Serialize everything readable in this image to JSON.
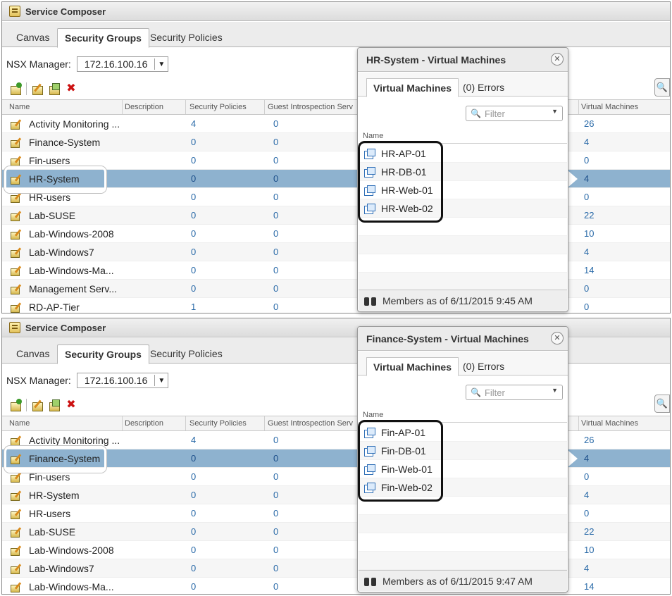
{
  "panels": [
    {
      "window_title": "Service Composer",
      "tabs": [
        "Canvas",
        "Security Groups",
        "Security Policies"
      ],
      "nsx_manager_label": "NSX Manager:",
      "nsx_manager_value": "172.16.100.16",
      "columns": [
        "Name",
        "Description",
        "Security Policies",
        "Guest Introspection Serv",
        "Virtual Machines"
      ],
      "rows": [
        {
          "name": "Activity Monitoring ...",
          "policies": "4",
          "gis": "0",
          "vms": "26"
        },
        {
          "name": "Finance-System",
          "policies": "0",
          "gis": "0",
          "vms": "4"
        },
        {
          "name": "Fin-users",
          "policies": "0",
          "gis": "0",
          "vms": "0"
        },
        {
          "name": "HR-System",
          "policies": "0",
          "gis": "0",
          "vms": "4"
        },
        {
          "name": "HR-users",
          "policies": "0",
          "gis": "0",
          "vms": "0"
        },
        {
          "name": "Lab-SUSE",
          "policies": "0",
          "gis": "0",
          "vms": "22"
        },
        {
          "name": "Lab-Windows-2008",
          "policies": "0",
          "gis": "0",
          "vms": "10"
        },
        {
          "name": "Lab-Windows7",
          "policies": "0",
          "gis": "0",
          "vms": "4"
        },
        {
          "name": "Lab-Windows-Ma...",
          "policies": "0",
          "gis": "0",
          "vms": "14"
        },
        {
          "name": "Management Serv...",
          "policies": "0",
          "gis": "0",
          "vms": "0"
        },
        {
          "name": "RD-AP-Tier",
          "policies": "1",
          "gis": "0",
          "vms": "0"
        }
      ],
      "popup": {
        "title": "HR-System - Virtual Machines",
        "tab_vms": "Virtual Machines",
        "tab_errors": "(0) Errors",
        "filter_placeholder": "Filter",
        "list_header": "Name",
        "vms": [
          "HR-AP-01",
          "HR-DB-01",
          "HR-Web-01",
          "HR-Web-02"
        ],
        "footer": "Members as of 6/11/2015 9:45 AM"
      }
    },
    {
      "window_title": "Service Composer",
      "tabs": [
        "Canvas",
        "Security Groups",
        "Security Policies"
      ],
      "nsx_manager_label": "NSX Manager:",
      "nsx_manager_value": "172.16.100.16",
      "columns": [
        "Name",
        "Description",
        "Security Policies",
        "Guest Introspection Serv",
        "Virtual Machines"
      ],
      "rows": [
        {
          "name": "Activity Monitoring ...",
          "policies": "4",
          "gis": "0",
          "vms": "26"
        },
        {
          "name": "Finance-System",
          "policies": "0",
          "gis": "0",
          "vms": "4"
        },
        {
          "name": "Fin-users",
          "policies": "0",
          "gis": "0",
          "vms": "0"
        },
        {
          "name": "HR-System",
          "policies": "0",
          "gis": "0",
          "vms": "4"
        },
        {
          "name": "HR-users",
          "policies": "0",
          "gis": "0",
          "vms": "0"
        },
        {
          "name": "Lab-SUSE",
          "policies": "0",
          "gis": "0",
          "vms": "22"
        },
        {
          "name": "Lab-Windows-2008",
          "policies": "0",
          "gis": "0",
          "vms": "10"
        },
        {
          "name": "Lab-Windows7",
          "policies": "0",
          "gis": "0",
          "vms": "4"
        },
        {
          "name": "Lab-Windows-Ma...",
          "policies": "0",
          "gis": "0",
          "vms": "14"
        }
      ],
      "popup": {
        "title": "Finance-System - Virtual Machines",
        "tab_vms": "Virtual Machines",
        "tab_errors": "(0) Errors",
        "filter_placeholder": "Filter",
        "list_header": "Name",
        "vms": [
          "Fin-AP-01",
          "Fin-DB-01",
          "Fin-Web-01",
          "Fin-Web-02"
        ],
        "footer": "Members as of 6/11/2015 9:47 AM"
      }
    }
  ],
  "colors": {
    "selected_row": "#8eb2cf",
    "link_number": "#2a6aa8",
    "delete_icon": "#cc1111"
  }
}
